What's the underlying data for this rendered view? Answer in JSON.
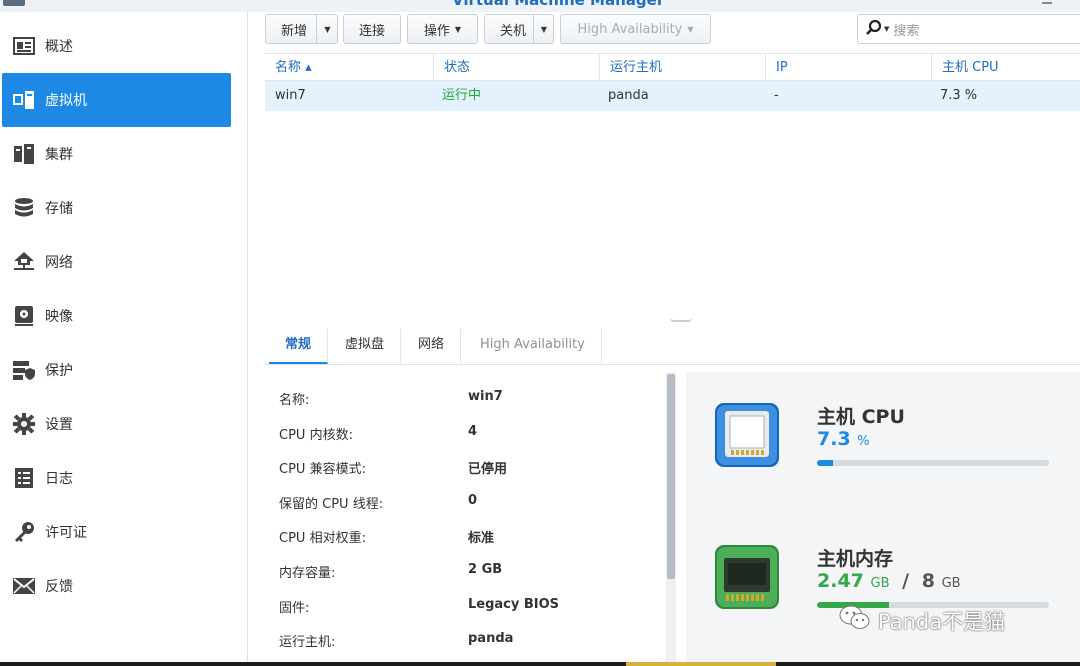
{
  "window": {
    "title": "Virtual Machine Manager"
  },
  "sidebar": {
    "items": [
      {
        "label": "概述",
        "icon": "overview-icon",
        "active": false
      },
      {
        "label": "虚拟机",
        "icon": "virtual-machine-icon",
        "active": true
      },
      {
        "label": "集群",
        "icon": "cluster-icon",
        "active": false
      },
      {
        "label": "存储",
        "icon": "storage-icon",
        "active": false
      },
      {
        "label": "网络",
        "icon": "network-icon",
        "active": false
      },
      {
        "label": "映像",
        "icon": "image-icon",
        "active": false
      },
      {
        "label": "保护",
        "icon": "protection-icon",
        "active": false
      },
      {
        "label": "设置",
        "icon": "gear-icon",
        "active": false
      },
      {
        "label": "日志",
        "icon": "log-icon",
        "active": false
      },
      {
        "label": "许可证",
        "icon": "license-key-icon",
        "active": false
      },
      {
        "label": "反馈",
        "icon": "feedback-mail-icon",
        "active": false
      }
    ]
  },
  "toolbar": {
    "new_label": "新增",
    "connect_label": "连接",
    "action_label": "操作",
    "shutdown_label": "关机",
    "ha_label": "High Availability"
  },
  "search": {
    "placeholder": "搜索"
  },
  "grid": {
    "columns": [
      "名称 ▴",
      "状态",
      "运行主机",
      "IP",
      "主机 CPU"
    ],
    "rows": [
      {
        "name": "win7",
        "status": "运行中",
        "host": "panda",
        "ip": "-",
        "cpu": "7.3 %"
      }
    ]
  },
  "tabs": [
    {
      "label": "常规",
      "active": true
    },
    {
      "label": "虚拟盘",
      "active": false
    },
    {
      "label": "网络",
      "active": false
    },
    {
      "label": "High Availability",
      "active": false
    }
  ],
  "detail": {
    "rows": [
      {
        "label": "名称:",
        "value": "win7"
      },
      {
        "label": "CPU 内核数:",
        "value": "4"
      },
      {
        "label": "CPU 兼容模式:",
        "value": "已停用"
      },
      {
        "label": "保留的 CPU 线程:",
        "value": "0"
      },
      {
        "label": "CPU 相对权重:",
        "value": "标准"
      },
      {
        "label": "内存容量:",
        "value": "2 GB"
      },
      {
        "label": "固件:",
        "value": "Legacy BIOS"
      },
      {
        "label": "运行主机:",
        "value": "panda"
      }
    ]
  },
  "status": {
    "cpu": {
      "name": "主机 CPU",
      "value": "7.3",
      "unit": "%",
      "usage_fraction": 0.07,
      "icon": "cpu-chip-icon"
    },
    "memory": {
      "name": "主机内存",
      "used": "2.47",
      "used_unit": "GB",
      "separator": "/",
      "total": "8",
      "total_unit": "GB",
      "usage_fraction": 0.31,
      "icon": "memory-module-icon"
    }
  },
  "watermark": {
    "text": "Panda不是猫"
  },
  "colors": {
    "accent": "#1e88e5",
    "running": "#22a63a",
    "memory": "#35a84a",
    "selected_row": "#e4f2fd"
  }
}
